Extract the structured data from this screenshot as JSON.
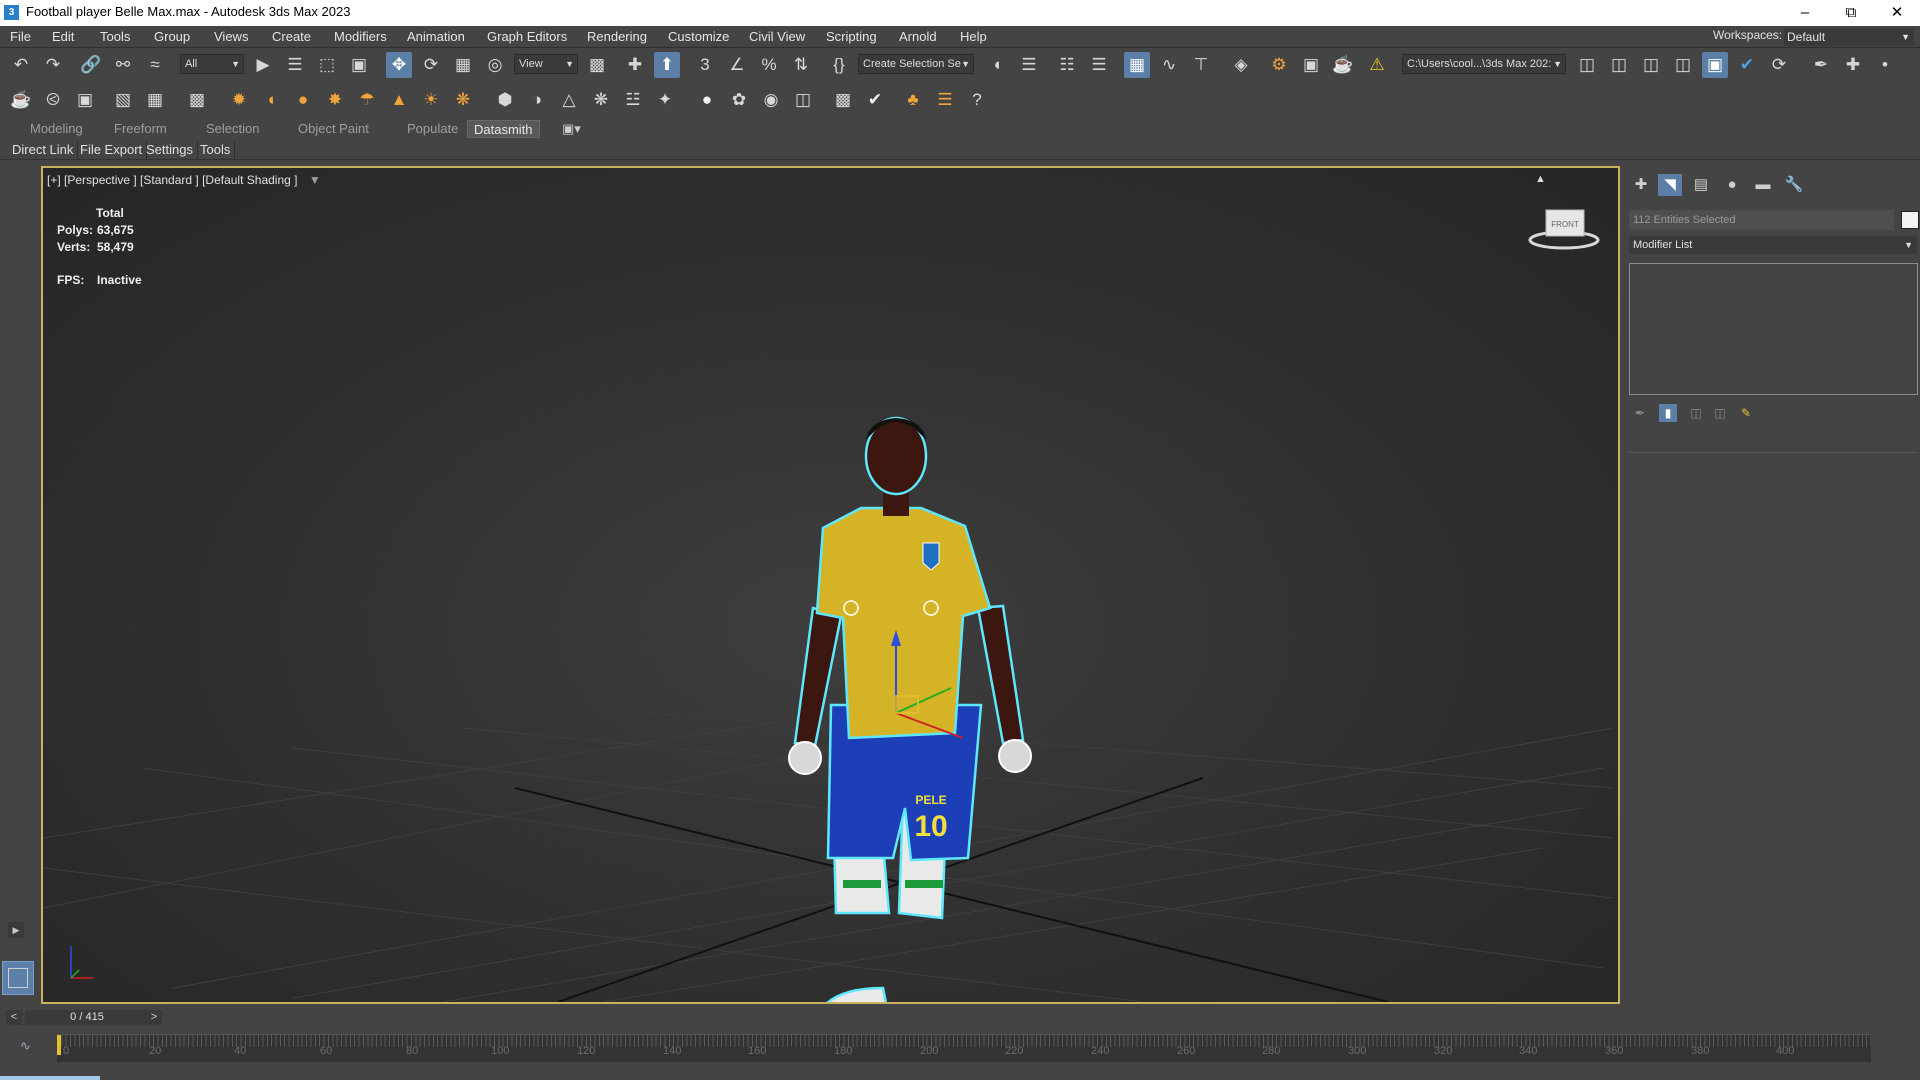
{
  "window": {
    "title": "Football player Belle Max.max - Autodesk 3ds Max 2023"
  },
  "menu": [
    "File",
    "Edit",
    "Tools",
    "Group",
    "Views",
    "Create",
    "Modifiers",
    "Animation",
    "Graph Editors",
    "Rendering",
    "Customize",
    "Civil View",
    "Scripting",
    "Arnold",
    "Help"
  ],
  "workspaces": {
    "label": "Workspaces:",
    "value": "Default"
  },
  "toolbar": {
    "filter_value": "All",
    "refcoord_value": "View",
    "named_selection_placeholder": "Create Selection Se",
    "project_path": "C:\\Users\\cool...\\3ds Max 202:"
  },
  "ribbon_tabs": [
    "Modeling",
    "Freeform",
    "Selection",
    "Object Paint",
    "Populate",
    "Datasmith"
  ],
  "ribbon_active": "Datasmith",
  "sub_tabs": [
    "Direct Link",
    "File Export",
    "Settings",
    "Tools"
  ],
  "viewport": {
    "label": "[+] [Perspective ] [Standard ] [Default Shading ]",
    "stats_title": "Total",
    "stats": [
      {
        "key": "Polys:",
        "value": "63,675"
      },
      {
        "key": "Verts:",
        "value": "58,479"
      }
    ],
    "fps_label": "FPS:",
    "fps_value": "Inactive",
    "viewcube_text": "FRONT",
    "jersey_name": "PELE",
    "jersey_number": "10"
  },
  "command_panel": {
    "entities": "112 Entities Selected",
    "modifier_list": "Modifier List"
  },
  "timeline": {
    "frame_display": "0 / 415",
    "prev": "<",
    "next": ">",
    "ticks": [
      "0",
      "20",
      "40",
      "60",
      "80",
      "100",
      "120",
      "140",
      "160",
      "180",
      "200",
      "220",
      "240",
      "260",
      "280",
      "300",
      "320",
      "340",
      "360",
      "380",
      "400"
    ]
  },
  "colors": {
    "selection_outline": "#5ee8ff",
    "viewport_border": "#c9b25c",
    "active_tool": "#5b7fa6"
  }
}
